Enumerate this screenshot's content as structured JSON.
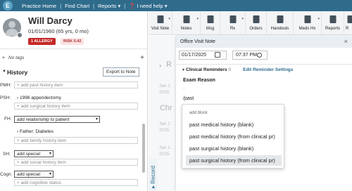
{
  "topnav": {
    "logo": "E",
    "items": [
      "Practice Home",
      "Find Chart",
      "Reports ▾",
      "I need help ▾"
    ]
  },
  "patient": {
    "name": "Will Darcy",
    "dob": "01/01/1960 (65 yrs, 0 mo)",
    "allergy_badge": "1 ALLERGY",
    "risk_badge": "RISK 0.42"
  },
  "tags": {
    "text": "No tags",
    "add": "+"
  },
  "history": {
    "title": "History",
    "export_label": "Export to Note",
    "pmh_label": "PMH:",
    "pmh_placeholder": "add past history item",
    "psh_label": "PSH:",
    "psh_item": "1996 appendectomy",
    "psh_placeholder": "add surgical history item",
    "fh_label": "FH:",
    "fh_select": "add relationship to patient",
    "fh_item": "Father: Diabetes",
    "fh_placeholder": "add family history item",
    "sh_label": "SH:",
    "sh_select": "add special",
    "sh_placeholder": "add social history item",
    "cogn_label": "Cogn:",
    "cogn_select": "add special",
    "cogn_placeholder": "add cognitive status"
  },
  "toolbar": {
    "buttons": [
      "Visit Note",
      "Notes",
      "Msg",
      "Rx",
      "Orders",
      "Handouts",
      "Meds Hx",
      "Reports",
      "R"
    ]
  },
  "background": {
    "r_letter": "R",
    "chr_text": "Chr",
    "dates": [
      [
        "Jan 1",
        "2025"
      ],
      [
        "Jan 1",
        "2025"
      ],
      [
        "Jan 1",
        "2025"
      ]
    ],
    "record_tab": "Record"
  },
  "note": {
    "title": "Office Visit Note",
    "close": "×",
    "date": "01/17/2025",
    "time": "07:37 PM",
    "clinical_reminders": "Clinical Reminders",
    "reminders_count": "0",
    "edit_reminders": "Edit Reminder Settings",
    "exam_reason": "Exam Reason",
    "exam_dash": "-",
    "command": "/past"
  },
  "dropdown": {
    "header": "add block",
    "items": [
      "past medical history (blank)",
      "past medical history (from clinical pr)",
      "past surgical history (blank)",
      "past surgical history (from clinical pr)"
    ],
    "active_index": 3
  }
}
